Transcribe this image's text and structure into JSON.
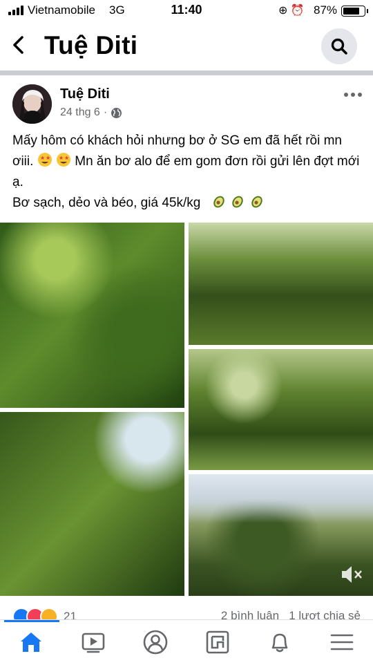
{
  "status_bar": {
    "carrier": "Vietnamobile",
    "network": "3G",
    "time": "11:40",
    "icons": "⊕ ⏰",
    "battery_percent": "87%",
    "battery_level": 0.87
  },
  "header": {
    "title": "Tuệ Diti",
    "back_icon": "chevron-left-icon",
    "search_icon": "search-icon"
  },
  "post": {
    "author": "Tuệ Diti",
    "date": "24 thg 6",
    "separator": "·",
    "privacy_icon": "globe-icon",
    "text_line1_a": "Mấy hôm có khách hỏi nhưng bơ ở SG em đã hết rồi mn ơiii.",
    "text_line1_b": "Mn ăn bơ alo để em gom đơn rồi gửi lên đợt mới ạ.",
    "text_line2": "Bơ sạch, dẻo và béo, giá 45k/kg",
    "photos": 5
  },
  "reactions": {
    "count": "21",
    "comments": "2 bình luận",
    "shares": "1 lượt chia sẻ",
    "types": [
      "like",
      "love",
      "care"
    ]
  },
  "bottom_nav": {
    "items": [
      "home-icon",
      "watch-icon",
      "profile-icon",
      "pages-icon",
      "notifications-icon",
      "menu-icon"
    ],
    "active_color": "#1877f2",
    "inactive_color": "#65676b"
  }
}
